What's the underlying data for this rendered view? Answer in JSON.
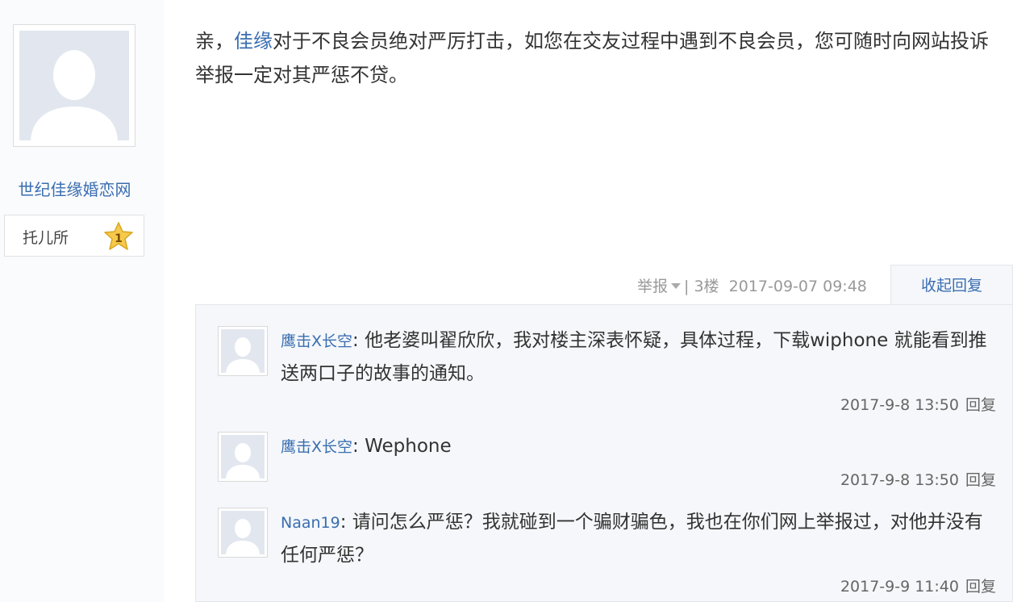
{
  "author": {
    "name": "世纪佳缘婚恋网",
    "level_name": "托儿所",
    "level_number": "1"
  },
  "post": {
    "prefix": "亲，",
    "link_text": "佳缘",
    "text": "对于不良会员绝对严厉打击，如您在交友过程中遇到不良会员，您可随时向网站投诉举报一定对其严惩不贷。",
    "report_label": "举报",
    "separator": "|",
    "floor": "3楼",
    "datetime": "2017-09-07 09:48",
    "collapse_label": "收起回复"
  },
  "replies": [
    {
      "user": "鹰击X长空",
      "colon": ": ",
      "text": "他老婆叫翟欣欣，我对楼主深表怀疑，具体过程，下载wiphone 就能看到推送两口子的故事的通知。",
      "time": "2017-9-8 13:50",
      "reply_label": "回复"
    },
    {
      "user": "鹰击X长空",
      "colon": ": ",
      "text": "Wephone",
      "time": "2017-9-8 13:50",
      "reply_label": "回复"
    },
    {
      "user": "Naan19",
      "colon": ": ",
      "text": "请问怎么严惩？我就碰到一个骗财骗色，我也在你们网上举报过，对他并没有任何严惩？",
      "time": "2017-9-9 11:40",
      "reply_label": "回复"
    }
  ],
  "colors": {
    "link": "#3a6eb0",
    "reply_bg": "#f5f7fa",
    "avatar_placeholder": "#e2e7ef",
    "star": "#f6c94a"
  },
  "icons": [
    "default-avatar-icon",
    "level-star-icon",
    "caret-down-icon"
  ]
}
